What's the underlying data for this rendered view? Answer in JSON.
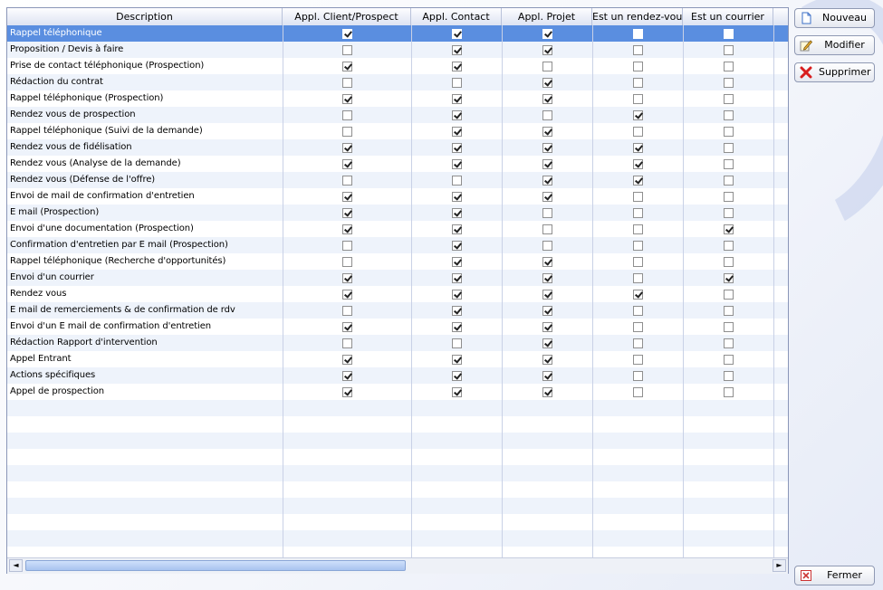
{
  "columns": [
    "Description",
    "Appl. Client/Prospect",
    "Appl. Contact",
    "Appl. Projet",
    "Est un rendez-vous",
    "Est un courrier"
  ],
  "rows": [
    {
      "label": "Rappel téléphonique",
      "checks": [
        true,
        true,
        true,
        false,
        false
      ],
      "selected": true
    },
    {
      "label": "Proposition / Devis à faire",
      "checks": [
        false,
        true,
        true,
        false,
        false
      ]
    },
    {
      "label": "Prise de contact téléphonique (Prospection)",
      "checks": [
        true,
        true,
        false,
        false,
        false
      ]
    },
    {
      "label": "Rédaction du contrat",
      "checks": [
        false,
        false,
        true,
        false,
        false
      ]
    },
    {
      "label": "Rappel téléphonique (Prospection)",
      "checks": [
        true,
        true,
        true,
        false,
        false
      ]
    },
    {
      "label": "Rendez vous de prospection",
      "checks": [
        false,
        true,
        false,
        true,
        false
      ]
    },
    {
      "label": "Rappel téléphonique (Suivi de la demande)",
      "checks": [
        false,
        true,
        true,
        false,
        false
      ]
    },
    {
      "label": "Rendez vous de fidélisation",
      "checks": [
        true,
        true,
        true,
        true,
        false
      ]
    },
    {
      "label": "Rendez vous (Analyse de la demande)",
      "checks": [
        true,
        true,
        true,
        true,
        false
      ]
    },
    {
      "label": "Rendez vous (Défense de l'offre)",
      "checks": [
        false,
        false,
        true,
        true,
        false
      ]
    },
    {
      "label": "Envoi de mail de confirmation d'entretien",
      "checks": [
        true,
        true,
        true,
        false,
        false
      ]
    },
    {
      "label": "E mail (Prospection)",
      "checks": [
        true,
        true,
        false,
        false,
        false
      ]
    },
    {
      "label": "Envoi d'une documentation (Prospection)",
      "checks": [
        true,
        true,
        false,
        false,
        true
      ]
    },
    {
      "label": "Confirmation d'entretien par E mail (Prospection)",
      "checks": [
        false,
        true,
        false,
        false,
        false
      ]
    },
    {
      "label": "Rappel téléphonique (Recherche d'opportunités)",
      "checks": [
        false,
        true,
        true,
        false,
        false
      ]
    },
    {
      "label": "Envoi d'un courrier",
      "checks": [
        true,
        true,
        true,
        false,
        true
      ]
    },
    {
      "label": "Rendez vous",
      "checks": [
        true,
        true,
        true,
        true,
        false
      ]
    },
    {
      "label": "E mail de remerciements & de confirmation de rdv",
      "checks": [
        false,
        true,
        true,
        false,
        false
      ]
    },
    {
      "label": "Envoi d'un E mail de confirmation d'entretien",
      "checks": [
        true,
        true,
        true,
        false,
        false
      ]
    },
    {
      "label": "Rédaction Rapport d'intervention",
      "checks": [
        false,
        false,
        true,
        false,
        false
      ]
    },
    {
      "label": "Appel Entrant",
      "checks": [
        true,
        true,
        true,
        false,
        false
      ]
    },
    {
      "label": "Actions spécifiques",
      "checks": [
        true,
        true,
        true,
        false,
        false
      ]
    },
    {
      "label": "Appel de prospection",
      "checks": [
        true,
        true,
        true,
        false,
        false
      ]
    }
  ],
  "buttons": {
    "nouveau": "Nouveau",
    "modifier": "Modifier",
    "supprimer": "Supprimer",
    "fermer": "Fermer"
  },
  "scrollbar": {
    "left_arrow": "◄",
    "right_arrow": "►"
  },
  "icons": {
    "nouveau": "new-document-icon",
    "modifier": "edit-pencil-icon",
    "supprimer": "delete-x-icon",
    "fermer": "close-x-icon"
  },
  "colors": {
    "selection": "#5a8ee0",
    "alt_row": "#eef3fb",
    "delete_red": "#d81e1e"
  }
}
